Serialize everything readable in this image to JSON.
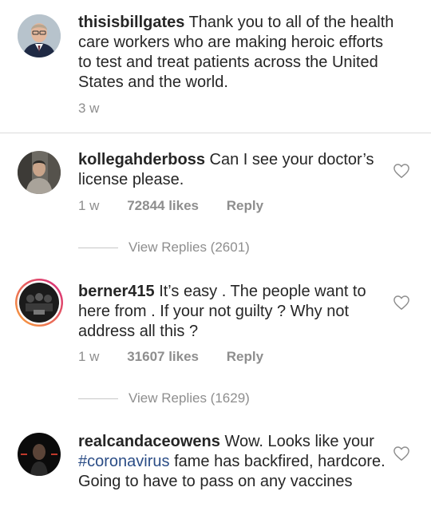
{
  "caption": {
    "username": "thisisbillgates",
    "text": "Thank you to all of the health care workers who are making heroic efforts to test and treat patients across the United States and the world.",
    "time": "3 w"
  },
  "comments": [
    {
      "username": "kollegahderboss",
      "text": "Can I see your doctor’s license please.",
      "time": "1 w",
      "likes": "72844 likes",
      "reply_label": "Reply",
      "view_replies": "View Replies (2601)"
    },
    {
      "username": "berner415",
      "text": "It’s easy . The people want to here from . If your not guilty ? Why not address all this ?",
      "time": "1 w",
      "likes": "31607 likes",
      "reply_label": "Reply",
      "view_replies": "View Replies (1629)"
    },
    {
      "username": "realcandaceowens",
      "text_before": "Wow. Looks like your ",
      "hashtag": "#coronavirus",
      "text_after": " fame has backfired, hardcore.",
      "text_line2": "Going to have to pass on any vaccines"
    }
  ],
  "colors": {
    "text": "#262626",
    "muted": "#8e8e8e",
    "hashtag": "#2b4d86",
    "divider": "#dbdbdb",
    "story_ring_start": "#f9a33a",
    "story_ring_end": "#d6257e"
  },
  "icons": [
    "heart-outline-icon"
  ]
}
